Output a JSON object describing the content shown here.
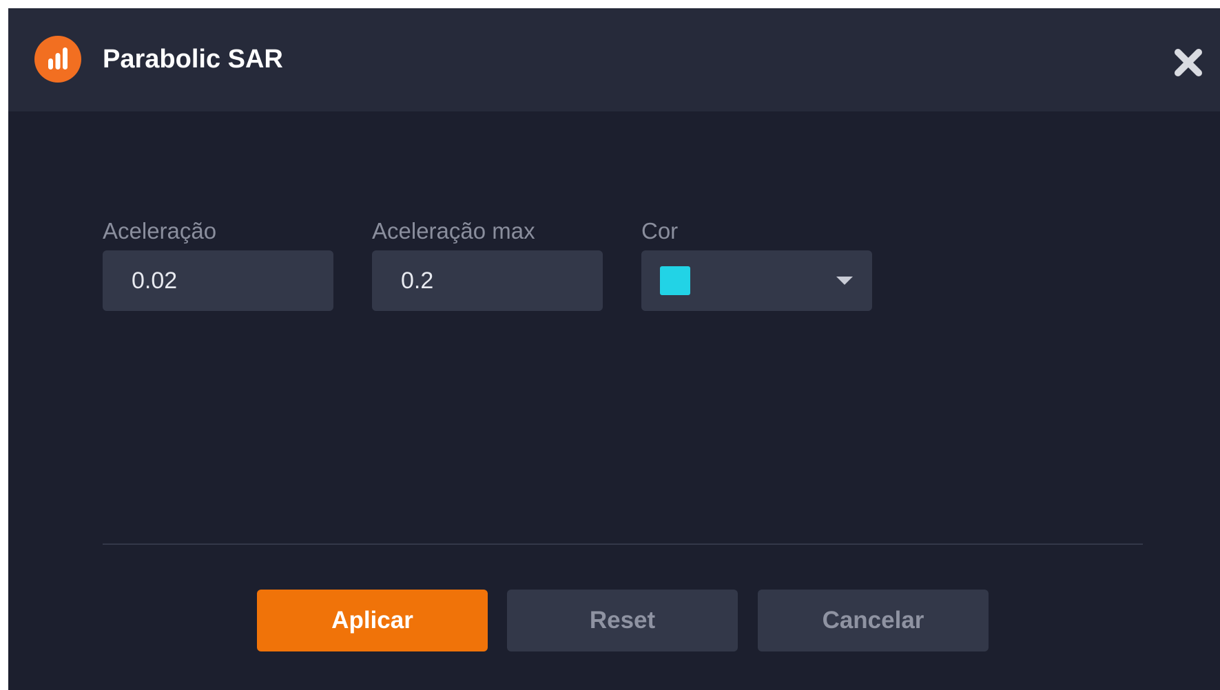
{
  "dialog": {
    "title": "Parabolic SAR",
    "icon": "indicator-chart-icon",
    "close_icon": "close-icon"
  },
  "fields": {
    "acceleration": {
      "label": "Aceleração",
      "value": "0.02"
    },
    "acceleration_max": {
      "label": "Aceleração max",
      "value": "0.2"
    },
    "color": {
      "label": "Cor",
      "value": "#22d3e6",
      "dropdown_icon": "caret-down-icon"
    }
  },
  "actions": {
    "apply_label": "Aplicar",
    "reset_label": "Reset",
    "cancel_label": "Cancelar"
  },
  "colors": {
    "accent": "#f07309",
    "icon_orange": "#f26f21",
    "background": "#1c1f2e",
    "header": "#262a3a",
    "input": "#333849"
  }
}
